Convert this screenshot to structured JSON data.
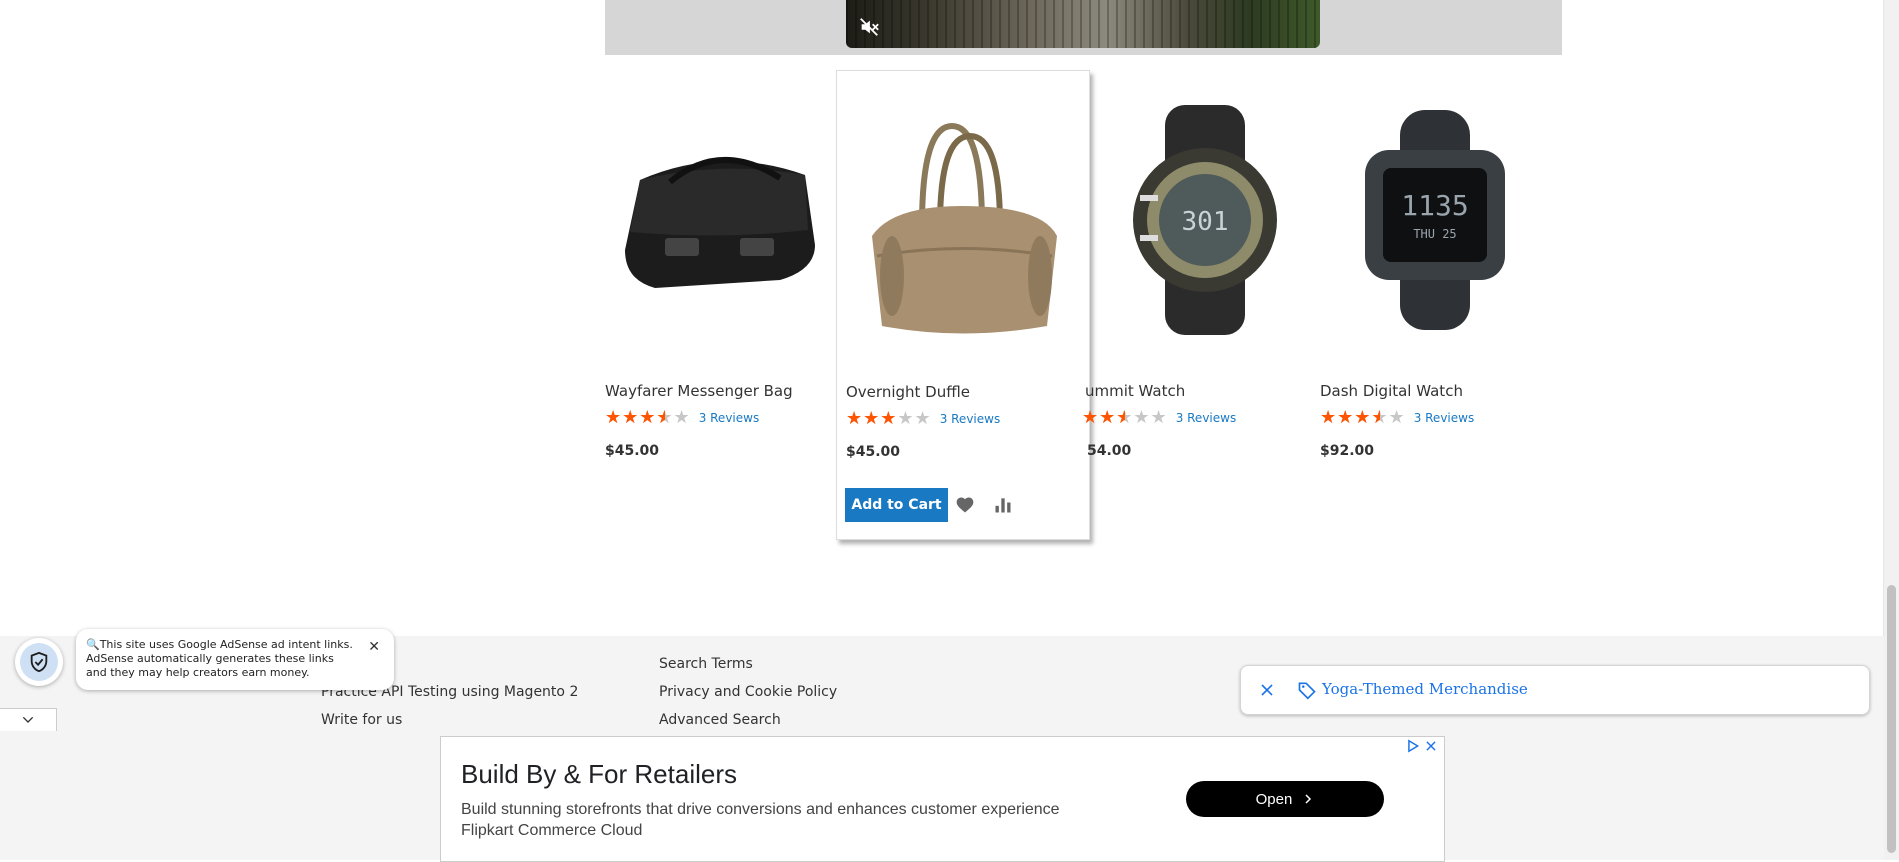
{
  "video": {
    "mute_icon": "speaker-muted-icon"
  },
  "products": [
    {
      "name": "Wayfarer Messenger Bag",
      "rating": 3.5,
      "reviews": "3 Reviews",
      "price": "$45.00"
    },
    {
      "name": "Overnight Duffle",
      "rating": 3,
      "reviews": "3 Reviews",
      "price": "$45.00",
      "add_to_cart": "Add to Cart",
      "wishlist_icon": "heart-icon",
      "compare_icon": "bar-chart-icon"
    },
    {
      "name": "ummit Watch",
      "rating": 2.5,
      "reviews": "3 Reviews",
      "price": "54.00"
    },
    {
      "name": "Dash Digital Watch",
      "rating": 3.5,
      "reviews": "3 Reviews",
      "price": "$92.00"
    }
  ],
  "footer": {
    "col1": [
      "Practice API Testing using Magento 2",
      "Write for us"
    ],
    "col2": [
      "Search Terms",
      "Privacy and Cookie Policy",
      "Advanced Search"
    ]
  },
  "adsense_notice": {
    "text": "This site uses Google AdSense ad intent links. AdSense automatically generates these links and they may help creators earn money.",
    "icon": "shield-check-icon"
  },
  "intent_chip": {
    "label": "Yoga-Themed Merchandise"
  },
  "ad": {
    "headline": "Build By & For Retailers",
    "line1": "Build stunning storefronts that drive conversions and enhances customer experience",
    "line2": "Flipkart Commerce Cloud",
    "cta": "Open"
  },
  "colors": {
    "accent": "#1979c3",
    "star": "#ff5501",
    "chip": "#1a73e8"
  }
}
